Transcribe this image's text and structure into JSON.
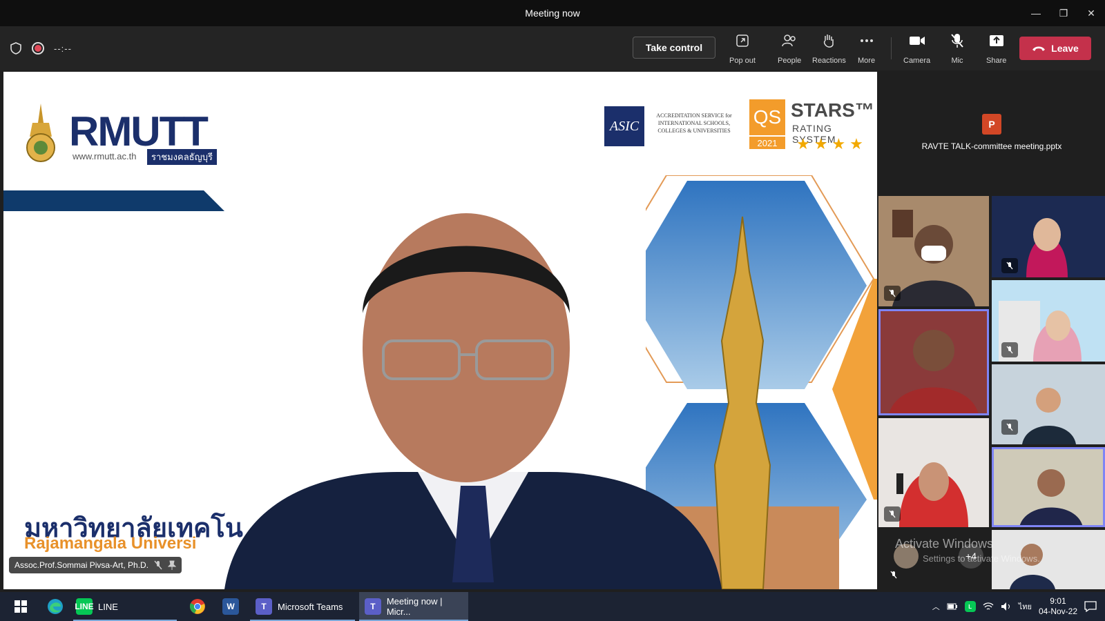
{
  "window": {
    "title": "Meeting now",
    "min": "—",
    "max": "❐",
    "close": "✕"
  },
  "toolbar": {
    "timer": "--:--",
    "take_control": "Take control",
    "buttons": {
      "popout": "Pop out",
      "people": "People",
      "reactions": "Reactions",
      "more": "More",
      "camera": "Camera",
      "mic": "Mic",
      "share": "Share"
    },
    "leave": "Leave",
    "leave_color": "#c4314b"
  },
  "stage": {
    "logo": "RMUTT",
    "url": "www.rmutt.ac.th",
    "thai_tag": "ราชมงคลธัญบุรี",
    "asic": "ASIC",
    "asic_text": "ACCREDITATION SERVICE for INTERNATIONAL SCHOOLS, COLLEGES & UNIVERSITIES",
    "qs": "QS",
    "qs_year": "2021",
    "stars_title": "STARS™",
    "stars_sub": "RATING SYSTEM",
    "stars": "★★★★",
    "thai_name": "มหาวิทยาลัยเทคโน",
    "eng_name": "Rajamangala Universi",
    "speaker_name": "Assoc.Prof.Sommai Pivsa-Art, Ph.D."
  },
  "panel": {
    "content_file": "RAVTE TALK-committee meeting.pptx",
    "ppt_icon_letter": "P",
    "overflow_count": "+4",
    "watermark_title": "Activate Windows",
    "watermark_sub": "Settings to activate Windows."
  },
  "taskbar": {
    "items": {
      "line": "LINE",
      "teams": "Microsoft Teams",
      "meeting": "Meeting now | Micr..."
    },
    "lang": "ไทย",
    "time": "9:01",
    "date": "04-Nov-22"
  },
  "colors": {
    "accent": "#7f85f5",
    "brand": "#1b2f6b",
    "orange": "#f39c2b"
  }
}
